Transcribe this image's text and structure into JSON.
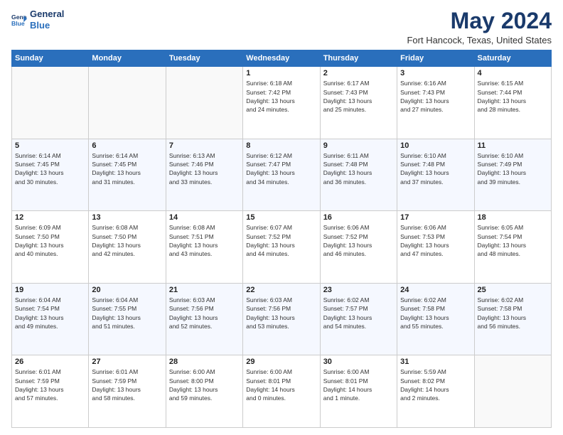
{
  "logo": {
    "line1": "General",
    "line2": "Blue"
  },
  "title": "May 2024",
  "subtitle": "Fort Hancock, Texas, United States",
  "header_days": [
    "Sunday",
    "Monday",
    "Tuesday",
    "Wednesday",
    "Thursday",
    "Friday",
    "Saturday"
  ],
  "weeks": [
    [
      {
        "day": "",
        "info": ""
      },
      {
        "day": "",
        "info": ""
      },
      {
        "day": "",
        "info": ""
      },
      {
        "day": "1",
        "info": "Sunrise: 6:18 AM\nSunset: 7:42 PM\nDaylight: 13 hours\nand 24 minutes."
      },
      {
        "day": "2",
        "info": "Sunrise: 6:17 AM\nSunset: 7:43 PM\nDaylight: 13 hours\nand 25 minutes."
      },
      {
        "day": "3",
        "info": "Sunrise: 6:16 AM\nSunset: 7:43 PM\nDaylight: 13 hours\nand 27 minutes."
      },
      {
        "day": "4",
        "info": "Sunrise: 6:15 AM\nSunset: 7:44 PM\nDaylight: 13 hours\nand 28 minutes."
      }
    ],
    [
      {
        "day": "5",
        "info": "Sunrise: 6:14 AM\nSunset: 7:45 PM\nDaylight: 13 hours\nand 30 minutes."
      },
      {
        "day": "6",
        "info": "Sunrise: 6:14 AM\nSunset: 7:45 PM\nDaylight: 13 hours\nand 31 minutes."
      },
      {
        "day": "7",
        "info": "Sunrise: 6:13 AM\nSunset: 7:46 PM\nDaylight: 13 hours\nand 33 minutes."
      },
      {
        "day": "8",
        "info": "Sunrise: 6:12 AM\nSunset: 7:47 PM\nDaylight: 13 hours\nand 34 minutes."
      },
      {
        "day": "9",
        "info": "Sunrise: 6:11 AM\nSunset: 7:48 PM\nDaylight: 13 hours\nand 36 minutes."
      },
      {
        "day": "10",
        "info": "Sunrise: 6:10 AM\nSunset: 7:48 PM\nDaylight: 13 hours\nand 37 minutes."
      },
      {
        "day": "11",
        "info": "Sunrise: 6:10 AM\nSunset: 7:49 PM\nDaylight: 13 hours\nand 39 minutes."
      }
    ],
    [
      {
        "day": "12",
        "info": "Sunrise: 6:09 AM\nSunset: 7:50 PM\nDaylight: 13 hours\nand 40 minutes."
      },
      {
        "day": "13",
        "info": "Sunrise: 6:08 AM\nSunset: 7:50 PM\nDaylight: 13 hours\nand 42 minutes."
      },
      {
        "day": "14",
        "info": "Sunrise: 6:08 AM\nSunset: 7:51 PM\nDaylight: 13 hours\nand 43 minutes."
      },
      {
        "day": "15",
        "info": "Sunrise: 6:07 AM\nSunset: 7:52 PM\nDaylight: 13 hours\nand 44 minutes."
      },
      {
        "day": "16",
        "info": "Sunrise: 6:06 AM\nSunset: 7:52 PM\nDaylight: 13 hours\nand 46 minutes."
      },
      {
        "day": "17",
        "info": "Sunrise: 6:06 AM\nSunset: 7:53 PM\nDaylight: 13 hours\nand 47 minutes."
      },
      {
        "day": "18",
        "info": "Sunrise: 6:05 AM\nSunset: 7:54 PM\nDaylight: 13 hours\nand 48 minutes."
      }
    ],
    [
      {
        "day": "19",
        "info": "Sunrise: 6:04 AM\nSunset: 7:54 PM\nDaylight: 13 hours\nand 49 minutes."
      },
      {
        "day": "20",
        "info": "Sunrise: 6:04 AM\nSunset: 7:55 PM\nDaylight: 13 hours\nand 51 minutes."
      },
      {
        "day": "21",
        "info": "Sunrise: 6:03 AM\nSunset: 7:56 PM\nDaylight: 13 hours\nand 52 minutes."
      },
      {
        "day": "22",
        "info": "Sunrise: 6:03 AM\nSunset: 7:56 PM\nDaylight: 13 hours\nand 53 minutes."
      },
      {
        "day": "23",
        "info": "Sunrise: 6:02 AM\nSunset: 7:57 PM\nDaylight: 13 hours\nand 54 minutes."
      },
      {
        "day": "24",
        "info": "Sunrise: 6:02 AM\nSunset: 7:58 PM\nDaylight: 13 hours\nand 55 minutes."
      },
      {
        "day": "25",
        "info": "Sunrise: 6:02 AM\nSunset: 7:58 PM\nDaylight: 13 hours\nand 56 minutes."
      }
    ],
    [
      {
        "day": "26",
        "info": "Sunrise: 6:01 AM\nSunset: 7:59 PM\nDaylight: 13 hours\nand 57 minutes."
      },
      {
        "day": "27",
        "info": "Sunrise: 6:01 AM\nSunset: 7:59 PM\nDaylight: 13 hours\nand 58 minutes."
      },
      {
        "day": "28",
        "info": "Sunrise: 6:00 AM\nSunset: 8:00 PM\nDaylight: 13 hours\nand 59 minutes."
      },
      {
        "day": "29",
        "info": "Sunrise: 6:00 AM\nSunset: 8:01 PM\nDaylight: 14 hours\nand 0 minutes."
      },
      {
        "day": "30",
        "info": "Sunrise: 6:00 AM\nSunset: 8:01 PM\nDaylight: 14 hours\nand 1 minute."
      },
      {
        "day": "31",
        "info": "Sunrise: 5:59 AM\nSunset: 8:02 PM\nDaylight: 14 hours\nand 2 minutes."
      },
      {
        "day": "",
        "info": ""
      }
    ]
  ]
}
